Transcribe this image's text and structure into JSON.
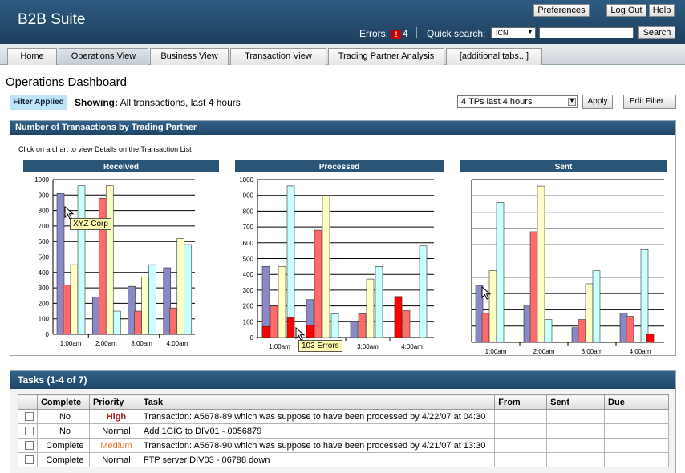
{
  "app": {
    "title": "B2B Suite"
  },
  "header": {
    "preferences": "Preferences",
    "logout": "Log Out",
    "help": "Help",
    "errors_label": "Errors:",
    "errors_icon": "!",
    "errors_count": "4",
    "quick_search_label": "Quick search:",
    "quick_search_type": "ICN",
    "search_button": "Search"
  },
  "tabs": [
    "Home",
    "Operations View",
    "Business View",
    "Transaction View",
    "Trading Partner Analysis",
    "[additional tabs...]"
  ],
  "page": {
    "title": "Operations Dashboard",
    "filter_badge": "Filter Applied",
    "showing_label": "Showing:",
    "showing_value": "All transactions, last 4 hours",
    "filter_select": "4 TPs last 4 hours",
    "apply": "Apply",
    "edit_filter": "Edit Filter..."
  },
  "panel": {
    "title": "Number of Transactions by Trading Partner",
    "note": "Click on a chart to view Details on the Transaction List"
  },
  "colors": {
    "s1": "#8a89c8",
    "s2": "#ff6b6b",
    "s3": "#ffffc6",
    "s4": "#c9ffff",
    "s5": "#ff0000"
  },
  "chart_data": [
    {
      "type": "bar",
      "title": "Received",
      "categories": [
        "1:00am",
        "2:00am",
        "3:00am",
        "4:00am"
      ],
      "ylim": [
        0,
        1000
      ],
      "yticks": [
        0,
        100,
        200,
        300,
        400,
        500,
        600,
        700,
        800,
        900,
        1000
      ],
      "show_ylabels": true,
      "series": [
        {
          "values": [
            910,
            240,
            310,
            430
          ]
        },
        {
          "values": [
            320,
            880,
            150,
            170
          ]
        },
        {
          "values": [
            450,
            960,
            370,
            620
          ]
        },
        {
          "values": [
            960,
            150,
            450,
            580
          ]
        }
      ],
      "tooltip": "XYZ Corp"
    },
    {
      "type": "bar",
      "title": "Processed",
      "categories": [
        "1:00am",
        "2:00am",
        "3:00am",
        "4:00am"
      ],
      "ylim": [
        0,
        1000
      ],
      "yticks": [
        0,
        100,
        200,
        300,
        400,
        500,
        600,
        700,
        800,
        900,
        1000
      ],
      "show_ylabels": true,
      "series": [
        {
          "values": [
            450,
            240,
            100,
            200
          ]
        },
        {
          "values": [
            200,
            680,
            150,
            170
          ]
        },
        {
          "values": [
            450,
            900,
            370,
            0
          ]
        },
        {
          "values": [
            960,
            150,
            450,
            580
          ]
        },
        {
          "values": [
            70,
            80,
            0,
            260
          ]
        },
        {
          "values": [
            125,
            0,
            0,
            0
          ]
        }
      ],
      "tooltip": "103 Errors"
    },
    {
      "type": "bar",
      "title": "Sent",
      "categories": [
        "1:00am",
        "2:00am",
        "3:00am",
        "4:00am"
      ],
      "ylim": [
        0,
        1000
      ],
      "yticks": [
        0,
        100,
        200,
        300,
        400,
        500,
        600,
        700,
        800,
        900,
        1000
      ],
      "show_ylabels": false,
      "series": [
        {
          "values": [
            350,
            230,
            90,
            180
          ]
        },
        {
          "values": [
            180,
            680,
            140,
            160
          ]
        },
        {
          "values": [
            440,
            960,
            360,
            0
          ]
        },
        {
          "values": [
            860,
            140,
            440,
            570
          ]
        },
        {
          "values": [
            0,
            0,
            0,
            50
          ]
        }
      ]
    }
  ],
  "tasks": {
    "title": "Tasks (1-4 of 7)",
    "columns": [
      "",
      "Complete",
      "Priority",
      "Task",
      "From",
      "Sent",
      "Due"
    ],
    "rows": [
      {
        "complete": "No",
        "priority": "High",
        "task": "Transaction: A5678-89 which was suppose to have been processed by 4/22/07 at 04:30",
        "from": "",
        "sent": "",
        "due": ""
      },
      {
        "complete": "No",
        "priority": "Normal",
        "task": "Add 1GIG to DIV01 - 0056879",
        "from": "",
        "sent": "",
        "due": ""
      },
      {
        "complete": "Complete",
        "priority": "Medium",
        "task": "Transaction: A5678-90 which was suppose to have been processed by 4/21/07 at 13:30",
        "from": "",
        "sent": "",
        "due": ""
      },
      {
        "complete": "Complete",
        "priority": "Normal",
        "task": "FTP server DIV03 - 06798 down",
        "from": "",
        "sent": "",
        "due": ""
      }
    ]
  }
}
